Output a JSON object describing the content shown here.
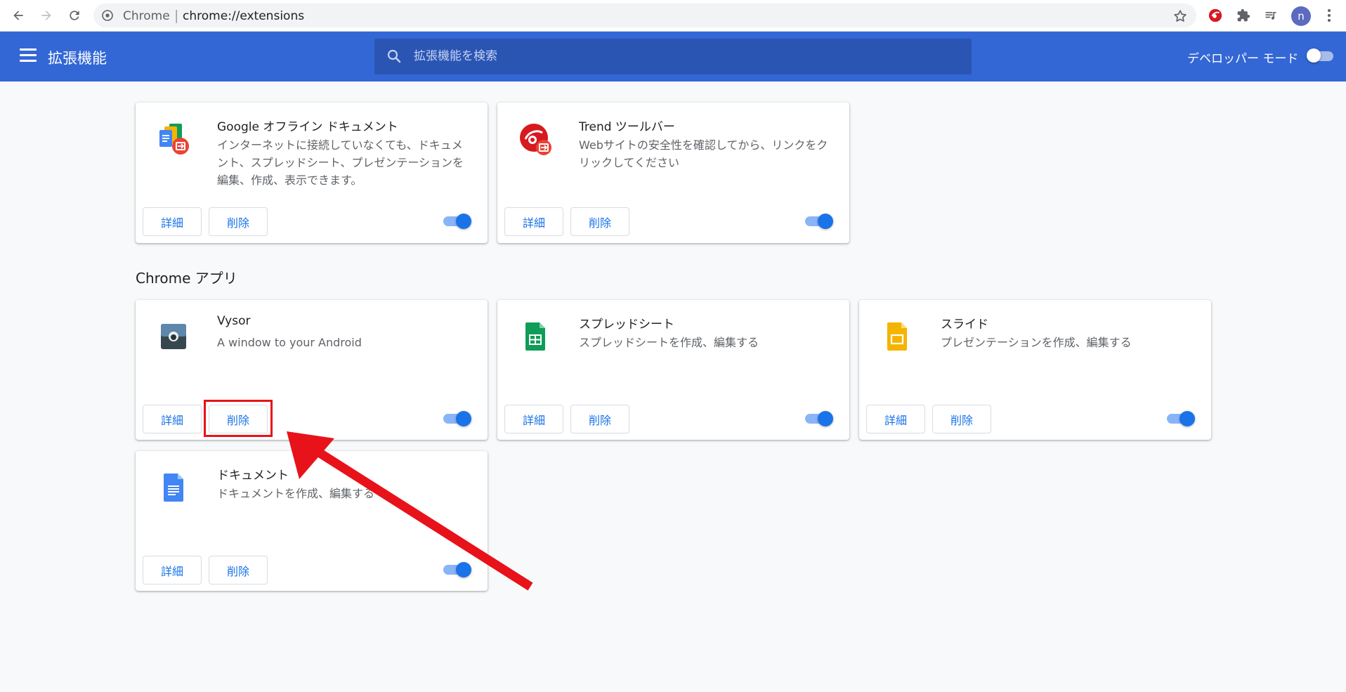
{
  "browser": {
    "omnibox": {
      "scheme_label": "Chrome",
      "separator": "|",
      "url": "chrome://extensions"
    },
    "avatar_letter": "n"
  },
  "header": {
    "title": "拡張機能",
    "search_placeholder": "拡張機能を検索",
    "developer_mode_label": "デベロッパー モード",
    "developer_mode_enabled": false
  },
  "extensions": [
    {
      "name": "Google オフライン ドキュメント",
      "description": "インターネットに接続していなくても、ドキュメント、スプレッドシート、プレゼンテーションを編集、作成、表示できます。",
      "icon": "google-docs-offline-icon",
      "details_label": "詳細",
      "remove_label": "削除",
      "enabled": true
    },
    {
      "name": "Trend ツールバー",
      "description": "Webサイトの安全性を確認してから、リンクをクリックしてください",
      "icon": "trend-micro-icon",
      "details_label": "詳細",
      "remove_label": "削除",
      "enabled": true
    }
  ],
  "apps_section_title": "Chrome アプリ",
  "apps": [
    {
      "name": "Vysor",
      "description": "A window to your Android",
      "icon": "vysor-icon",
      "details_label": "詳細",
      "remove_label": "削除",
      "enabled": true
    },
    {
      "name": "スプレッドシート",
      "description": "スプレッドシートを作成、編集する",
      "icon": "google-sheets-icon",
      "details_label": "詳細",
      "remove_label": "削除",
      "enabled": true
    },
    {
      "name": "スライド",
      "description": "プレゼンテーションを作成、編集する",
      "icon": "google-slides-icon",
      "details_label": "詳細",
      "remove_label": "削除",
      "enabled": true
    },
    {
      "name": "ドキュメント",
      "description": "ドキュメントを作成、編集する",
      "icon": "google-docs-icon",
      "details_label": "詳細",
      "remove_label": "削除",
      "enabled": true
    }
  ],
  "annotation": {
    "highlight_color": "#e8121a"
  }
}
